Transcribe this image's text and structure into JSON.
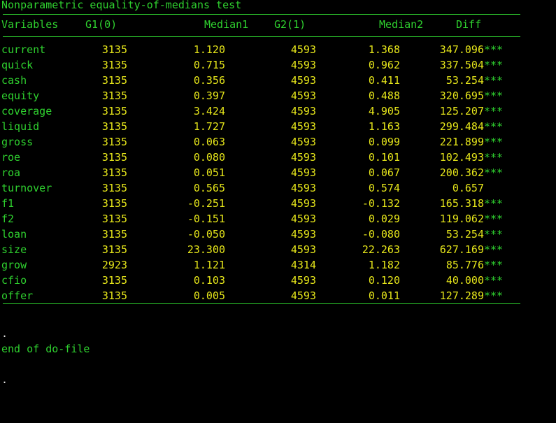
{
  "title": "Nonparametric equality-of-medians test",
  "headers": {
    "var": "Variables",
    "g1": "G1(0)",
    "median1": "Median1",
    "g2": "G2(1)",
    "median2": "Median2",
    "diff": "Diff"
  },
  "rows": [
    {
      "var": "current",
      "g1": "3135",
      "m1": "1.120",
      "g2": "4593",
      "m2": "1.368",
      "diff": "347.096",
      "stars": "***"
    },
    {
      "var": "quick",
      "g1": "3135",
      "m1": "0.715",
      "g2": "4593",
      "m2": "0.962",
      "diff": "337.504",
      "stars": "***"
    },
    {
      "var": "cash",
      "g1": "3135",
      "m1": "0.356",
      "g2": "4593",
      "m2": "0.411",
      "diff": "53.254",
      "stars": "***"
    },
    {
      "var": "equity",
      "g1": "3135",
      "m1": "0.397",
      "g2": "4593",
      "m2": "0.488",
      "diff": "320.695",
      "stars": "***"
    },
    {
      "var": "coverage",
      "g1": "3135",
      "m1": "3.424",
      "g2": "4593",
      "m2": "4.905",
      "diff": "125.207",
      "stars": "***"
    },
    {
      "var": "liquid",
      "g1": "3135",
      "m1": "1.727",
      "g2": "4593",
      "m2": "1.163",
      "diff": "299.484",
      "stars": "***"
    },
    {
      "var": "gross",
      "g1": "3135",
      "m1": "0.063",
      "g2": "4593",
      "m2": "0.099",
      "diff": "221.899",
      "stars": "***"
    },
    {
      "var": "roe",
      "g1": "3135",
      "m1": "0.080",
      "g2": "4593",
      "m2": "0.101",
      "diff": "102.493",
      "stars": "***"
    },
    {
      "var": "roa",
      "g1": "3135",
      "m1": "0.051",
      "g2": "4593",
      "m2": "0.067",
      "diff": "200.362",
      "stars": "***"
    },
    {
      "var": "turnover",
      "g1": "3135",
      "m1": "0.565",
      "g2": "4593",
      "m2": "0.574",
      "diff": "0.657",
      "stars": ""
    },
    {
      "var": "f1",
      "g1": "3135",
      "m1": "-0.251",
      "g2": "4593",
      "m2": "-0.132",
      "diff": "165.318",
      "stars": "***"
    },
    {
      "var": "f2",
      "g1": "3135",
      "m1": "-0.151",
      "g2": "4593",
      "m2": "0.029",
      "diff": "119.062",
      "stars": "***"
    },
    {
      "var": "loan",
      "g1": "3135",
      "m1": "-0.050",
      "g2": "4593",
      "m2": "-0.080",
      "diff": "53.254",
      "stars": "***"
    },
    {
      "var": "size",
      "g1": "3135",
      "m1": "23.300",
      "g2": "4593",
      "m2": "22.263",
      "diff": "627.169",
      "stars": "***"
    },
    {
      "var": "grow",
      "g1": "2923",
      "m1": "1.121",
      "g2": "4314",
      "m2": "1.182",
      "diff": "85.776",
      "stars": "***"
    },
    {
      "var": "cfio",
      "g1": "3135",
      "m1": "0.103",
      "g2": "4593",
      "m2": "0.120",
      "diff": "40.000",
      "stars": "***"
    },
    {
      "var": "offer",
      "g1": "3135",
      "m1": "0.005",
      "g2": "4593",
      "m2": "0.011",
      "diff": "127.289",
      "stars": "***"
    }
  ],
  "footer": {
    "dot1": ".",
    "end_text": "end of do-file",
    "dot2": "."
  },
  "colors": {
    "background": "#000000",
    "text_green": "#2fd12f",
    "text_yellow": "#e6e61a",
    "text_white": "#e8e8e8"
  }
}
